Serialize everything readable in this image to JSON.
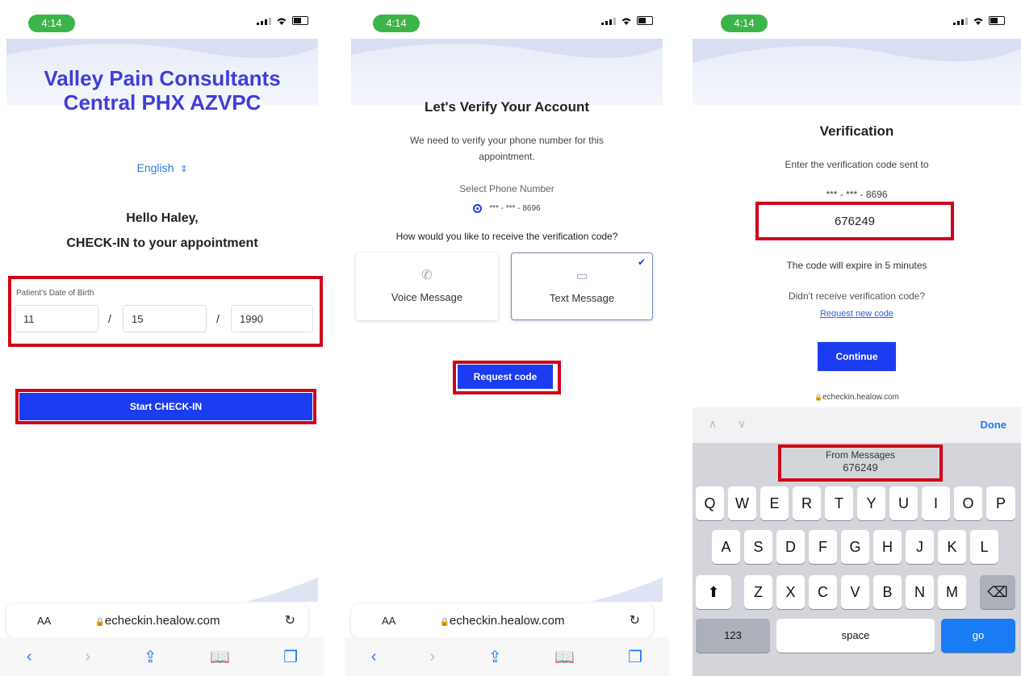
{
  "status": {
    "time": "4:14"
  },
  "browser": {
    "aa": "AA",
    "url": "echeckin.healow.com",
    "reload": "↻"
  },
  "screen1": {
    "title_line1": "Valley Pain Consultants",
    "title_line2": "Central PHX AZVPC",
    "language": "English",
    "greeting": "Hello Haley,",
    "subtitle": "CHECK-IN to your appointment",
    "dob_label": "Patient's Date of Birth",
    "dob_month": "11",
    "dob_day": "15",
    "dob_year": "1990",
    "separator": "/",
    "start_button": "Start CHECK-IN"
  },
  "screen2": {
    "title": "Let's Verify Your Account",
    "description": "We need to verify your phone number for this appointment.",
    "select_label": "Select Phone Number",
    "phone_masked": "*** - *** - 8696",
    "question": "How would you like to receive the verification code?",
    "option_voice": "Voice Message",
    "option_text": "Text Message",
    "request_button": "Request code"
  },
  "screen3": {
    "title": "Verification",
    "instruction": "Enter the verification code sent to",
    "phone_masked": "*** - *** - 8696",
    "code_value": "676249",
    "expire_text": "The code will expire in 5 minutes",
    "not_received": "Didn't receive verification code?",
    "request_new": "Request new code",
    "continue_button": "Continue",
    "mini_url": "echeckin.healow.com",
    "done": "Done",
    "suggestion_label": "From Messages",
    "suggestion_code": "676249",
    "keys_row1": [
      "Q",
      "W",
      "E",
      "R",
      "T",
      "Y",
      "U",
      "I",
      "O",
      "P"
    ],
    "keys_row2": [
      "A",
      "S",
      "D",
      "F",
      "G",
      "H",
      "J",
      "K",
      "L"
    ],
    "keys_row3": [
      "Z",
      "X",
      "C",
      "V",
      "B",
      "N",
      "M"
    ],
    "key_123": "123",
    "key_space": "space",
    "key_go": "go"
  },
  "colors": {
    "brand_blue": "#1b3cf0",
    "title_purple": "#3f3fd6",
    "highlight_red": "#d0021b",
    "status_green": "#3bb54a",
    "ios_blue": "#1a7cf5"
  }
}
